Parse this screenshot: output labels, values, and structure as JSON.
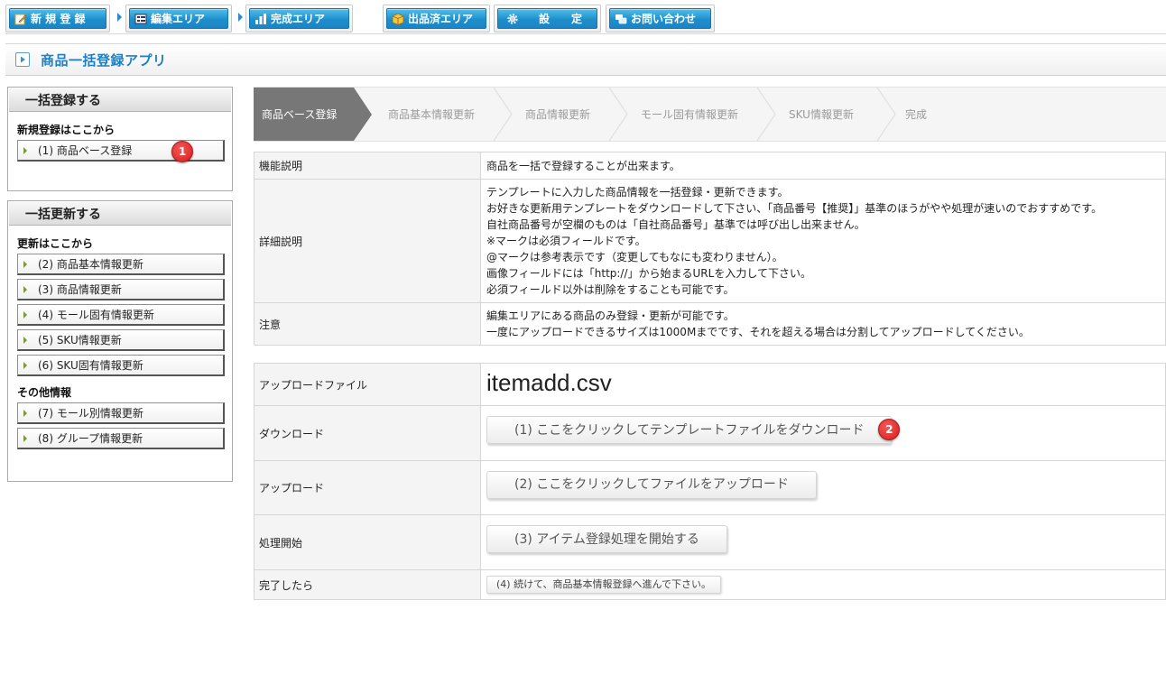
{
  "nav": {
    "buttons": [
      {
        "label": "新 規 登 録",
        "icon": "pencil-icon"
      },
      {
        "label": "編集エリア",
        "icon": "list-icon"
      },
      {
        "label": "完成エリア",
        "icon": "chart-icon"
      },
      {
        "label": "出品済エリア",
        "icon": "box-icon"
      },
      {
        "label": "設　　定",
        "icon": "gear-icon"
      },
      {
        "label": "お問い合わせ",
        "icon": "chat-icon"
      }
    ],
    "accent": "#1f8fcc"
  },
  "page": {
    "title": "商品一括登録アプリ",
    "title_color": "#1f7fc4"
  },
  "sidebar": {
    "register_panel": {
      "header": "一括登録する",
      "subheading": "新規登録はここから",
      "items": [
        {
          "label": "(1) 商品ベース登録",
          "badge": "1"
        }
      ]
    },
    "update_panel": {
      "header": "一括更新する",
      "subheading": "更新はここから",
      "items": [
        {
          "label": "(2) 商品基本情報更新"
        },
        {
          "label": "(3) 商品情報更新"
        },
        {
          "label": "(4) モール固有情報更新"
        },
        {
          "label": "(5) SKU情報更新"
        },
        {
          "label": "(6) SKU固有情報更新"
        }
      ],
      "other_subheading": "その他情報",
      "other_items": [
        {
          "label": "(7) モール別情報更新"
        },
        {
          "label": "(8) グループ情報更新"
        }
      ]
    }
  },
  "steps": {
    "active_index": 0,
    "items": [
      "商品ベース登録",
      "商品基本情報更新",
      "商品情報更新",
      "モール固有情報更新",
      "SKU情報更新",
      "完成"
    ]
  },
  "info_table": {
    "rows": [
      {
        "label": "機能説明",
        "lines": [
          "商品を一括で登録することが出来ます。"
        ]
      },
      {
        "label": "詳細説明",
        "lines": [
          "テンプレートに入力した商品情報を一括登録・更新できます。",
          "お好きな更新用テンプレートをダウンロードして下さい、「商品番号【推奨】」基準のほうがやや処理が速いのでおすすめです。",
          "自社商品番号が空欄のものは「自社商品番号」基準では呼び出し出来ません。",
          "※マークは必須フィールドです。",
          "@マークは参考表示です（変更してもなにも変わりません）。",
          "画像フィールドには「http://」から始まるURLを入力して下さい。",
          "必須フィールド以外は削除をすることも可能です。"
        ]
      },
      {
        "label": "注意",
        "lines": [
          "編集エリアにある商品のみ登録・更新が可能です。",
          "一度にアップロードできるサイズは1000Mまでです、それを超える場合は分割してアップロードしてください。"
        ]
      }
    ]
  },
  "upload_table": {
    "file_label": "アップロードファイル",
    "file_name": "itemadd.csv",
    "download_label": "ダウンロード",
    "download_button": "(1) ここをクリックしてテンプレートファイルをダウンロード",
    "download_badge": "2",
    "upload_label": "アップロード",
    "upload_button": "(2) ここをクリックしてファイルをアップロード",
    "process_label": "処理開始",
    "process_button": "(3) アイテム登録処理を開始する",
    "done_label": "完了したら",
    "done_button": "(4) 続けて、商品基本情報登録へ進んで下さい。"
  }
}
